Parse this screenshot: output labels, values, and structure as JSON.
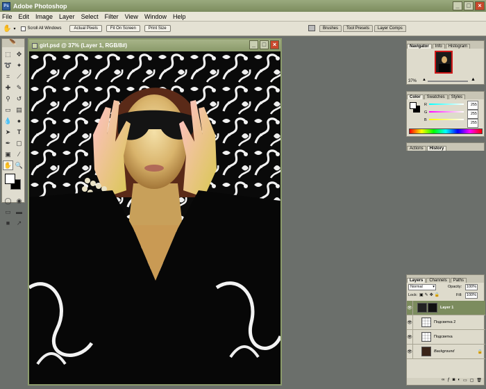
{
  "app": {
    "title": "Adobe Photoshop"
  },
  "menu": {
    "items": [
      "File",
      "Edit",
      "Image",
      "Layer",
      "Select",
      "Filter",
      "View",
      "Window",
      "Help"
    ]
  },
  "options": {
    "scroll_all": "Scroll All Windows",
    "buttons": [
      "Actual Pixels",
      "Fit On Screen",
      "Print Size"
    ],
    "well_tabs": [
      "Brushes",
      "Tool Presets",
      "Layer Comps"
    ]
  },
  "document": {
    "title": "girl.psd @ 37% (Layer 1, RGB/8#)"
  },
  "navigator": {
    "tabs": [
      "Navigator",
      "Info",
      "Histogram"
    ],
    "zoom": "37%"
  },
  "color": {
    "tabs": [
      "Color",
      "Swatches",
      "Styles"
    ],
    "channels": [
      {
        "label": "R",
        "value": "255"
      },
      {
        "label": "G",
        "value": "255"
      },
      {
        "label": "B",
        "value": "255"
      }
    ]
  },
  "history": {
    "tabs": [
      "Actions",
      "History"
    ]
  },
  "layers": {
    "tabs": [
      "Layers",
      "Channels",
      "Paths"
    ],
    "blend_mode": "Normal",
    "opacity_label": "Opacity:",
    "opacity": "100%",
    "lock_label": "Lock:",
    "fill_label": "Fill:",
    "fill": "100%",
    "items": [
      "Layer 1",
      "Подсветка 2",
      "Подсветка",
      "Background"
    ]
  },
  "colors": {
    "title_bar": "#8a9a6a",
    "selected_layer": "#7c8c5e"
  }
}
